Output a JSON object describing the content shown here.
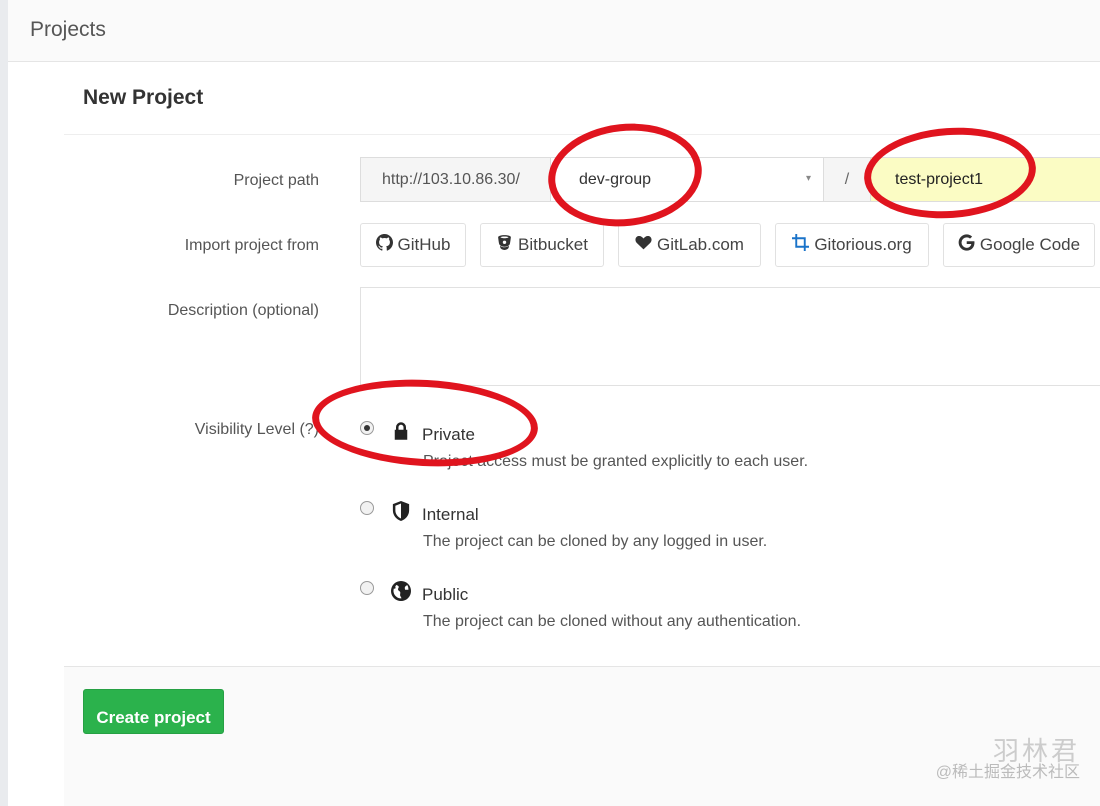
{
  "topbar": {
    "title": "Projects"
  },
  "page": {
    "title": "New Project"
  },
  "form": {
    "project_path": {
      "label": "Project path",
      "prefix": "http://103.10.86.30/",
      "namespace": "dev-group",
      "separator": "/",
      "name": "test-project1"
    },
    "import": {
      "label": "Import project from",
      "sources": [
        {
          "label": "GitHub",
          "icon": "github-icon"
        },
        {
          "label": "Bitbucket",
          "icon": "bitbucket-icon"
        },
        {
          "label": "GitLab.com",
          "icon": "heart-icon"
        },
        {
          "label": "Gitorious.org",
          "icon": "crop-icon"
        },
        {
          "label": "Google Code",
          "icon": "google-icon"
        }
      ]
    },
    "description": {
      "label": "Description (optional)",
      "value": ""
    },
    "visibility": {
      "label": "Visibility Level (?)",
      "options": [
        {
          "title": "Private",
          "desc": "Project access must be granted explicitly to each user.",
          "icon": "lock-icon",
          "checked": true
        },
        {
          "title": "Internal",
          "desc": "The project can be cloned by any logged in user.",
          "icon": "shield-icon",
          "checked": false
        },
        {
          "title": "Public",
          "desc": "The project can be cloned without any authentication.",
          "icon": "globe-icon",
          "checked": false
        }
      ]
    },
    "submit_label": "Create project"
  },
  "watermark": {
    "line1": "羽林君",
    "line2": "@稀土掘金技术社区"
  },
  "colors": {
    "primary_button": "#2bb24c",
    "annotation_ring": "#e0141e",
    "name_field_bg": "#fbfcc4"
  }
}
